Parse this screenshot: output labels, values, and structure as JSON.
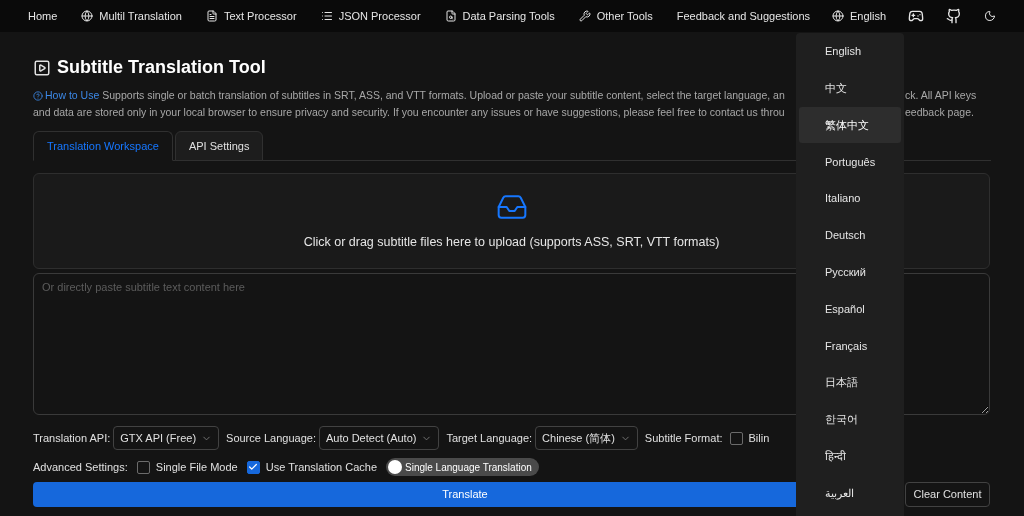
{
  "nav": {
    "items": [
      "Home",
      "Multil Translation",
      "Text Processor",
      "JSON Processor",
      "Data Parsing Tools",
      "Other Tools",
      "Feedback and Suggestions"
    ],
    "language": "English"
  },
  "title": "Subtitle Translation Tool",
  "description": {
    "link": "How to Use",
    "line_1_left": "Supports single or batch translation of subtitles in SRT, ASS, and VTT formats. Upload or paste your subtitle content, select the target language, an",
    "line_1_right": "ck. All API keys",
    "line_2_left": "and data are stored only in your local browser to ensure privacy and security. If you encounter any issues or have suggestions, please feel free to contact us throu",
    "line_2_right": "eedback page."
  },
  "tabs": [
    {
      "label": "Translation Workspace",
      "selected": true
    },
    {
      "label": "API Settings",
      "selected": false
    }
  ],
  "upload": {
    "text": "Click or drag subtitle files here to upload (supports ASS, SRT, VTT formats)"
  },
  "paste_area": {
    "placeholder": "Or directly paste subtitle text content here"
  },
  "options": [
    {
      "label": "Translation API:",
      "value": "GTX API (Free)"
    },
    {
      "label": "Source Language:",
      "value": "Auto Detect (Auto)"
    },
    {
      "label": "Target Language:",
      "value": "Chinese (简体)"
    }
  ],
  "subtitle_format": {
    "label": "Subtitle Format:",
    "checkbox": {
      "label": "Bilin",
      "checked": false
    }
  },
  "advanced": {
    "label": "Advanced Settings:",
    "checkboxes": [
      {
        "label": "Single File Mode",
        "checked": false
      },
      {
        "label": "Use Translation Cache",
        "checked": true
      }
    ],
    "switch": {
      "label": "Single Language Translation",
      "on": false
    }
  },
  "buttons": {
    "translate": "Translate",
    "clear": "Clear Content"
  },
  "language_menu": [
    {
      "label": "English",
      "selected": false
    },
    {
      "label": "中文",
      "selected": false
    },
    {
      "label": "繁体中文",
      "selected": true
    },
    {
      "label": "Português",
      "selected": false
    },
    {
      "label": "Italiano",
      "selected": false
    },
    {
      "label": "Deutsch",
      "selected": false
    },
    {
      "label": "Русский",
      "selected": false
    },
    {
      "label": "Español",
      "selected": false
    },
    {
      "label": "Français",
      "selected": false
    },
    {
      "label": "日本語",
      "selected": false
    },
    {
      "label": "한국어",
      "selected": false
    },
    {
      "label": "हिन्दी",
      "selected": false
    },
    {
      "label": "العربية",
      "selected": false
    }
  ]
}
